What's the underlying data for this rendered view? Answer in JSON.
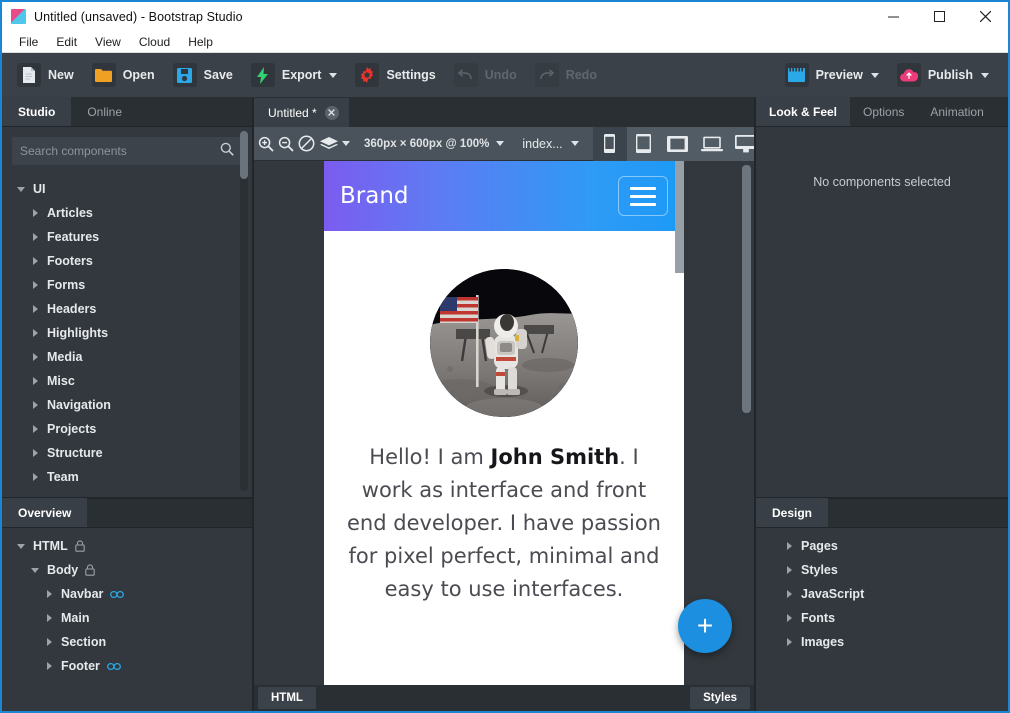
{
  "window": {
    "title": "Untitled (unsaved) - Bootstrap Studio",
    "app_icon": "bootstrap-studio-logo",
    "minimize": "minimize-icon",
    "maximize": "maximize-icon",
    "close": "close-icon"
  },
  "menubar": {
    "items": [
      {
        "label": "File"
      },
      {
        "label": "Edit"
      },
      {
        "label": "View"
      },
      {
        "label": "Cloud"
      },
      {
        "label": "Help"
      }
    ]
  },
  "toolbar": {
    "buttons": [
      {
        "label": "New",
        "icon": "new-file-icon",
        "color": "#d7dde3",
        "dropdown": false,
        "disabled": false
      },
      {
        "label": "Open",
        "icon": "folder-icon",
        "color": "#f0a023",
        "dropdown": false,
        "disabled": false
      },
      {
        "label": "Save",
        "icon": "floppy-icon",
        "color": "#2aa8e8",
        "dropdown": false,
        "disabled": false
      },
      {
        "label": "Export",
        "icon": "lightning-icon",
        "color": "#2fd46f",
        "dropdown": true,
        "disabled": false
      },
      {
        "label": "Settings",
        "icon": "gear-icon",
        "color": "#e8342c",
        "dropdown": false,
        "disabled": false
      },
      {
        "label": "Undo",
        "icon": "undo-arrow-icon",
        "color": "#8d959c",
        "dropdown": false,
        "disabled": true
      },
      {
        "label": "Redo",
        "icon": "redo-arrow-icon",
        "color": "#8d959c",
        "dropdown": false,
        "disabled": true
      }
    ],
    "right_buttons": [
      {
        "label": "Preview",
        "icon": "browser-window-icon",
        "color": "#2aa8e8",
        "dropdown": true
      },
      {
        "label": "Publish",
        "icon": "cloud-upload-icon",
        "color": "#ec3b79",
        "dropdown": true
      }
    ]
  },
  "left_panel": {
    "tabs": [
      {
        "label": "Studio",
        "active": true
      },
      {
        "label": "Online",
        "active": false
      }
    ],
    "search": {
      "placeholder": "Search components",
      "value": "",
      "icon": "search-icon"
    },
    "tree": [
      {
        "label": "UI",
        "level": 0,
        "expanded": true
      },
      {
        "label": "Articles",
        "level": 1,
        "expanded": false
      },
      {
        "label": "Features",
        "level": 1,
        "expanded": false
      },
      {
        "label": "Footers",
        "level": 1,
        "expanded": false
      },
      {
        "label": "Forms",
        "level": 1,
        "expanded": false
      },
      {
        "label": "Headers",
        "level": 1,
        "expanded": false
      },
      {
        "label": "Highlights",
        "level": 1,
        "expanded": false
      },
      {
        "label": "Media",
        "level": 1,
        "expanded": false
      },
      {
        "label": "Misc",
        "level": 1,
        "expanded": false
      },
      {
        "label": "Navigation",
        "level": 1,
        "expanded": false
      },
      {
        "label": "Projects",
        "level": 1,
        "expanded": false
      },
      {
        "label": "Structure",
        "level": 1,
        "expanded": false
      },
      {
        "label": "Team",
        "level": 1,
        "expanded": false
      }
    ]
  },
  "overview_panel": {
    "tabs": [
      {
        "label": "Overview",
        "active": true
      }
    ],
    "tree": [
      {
        "label": "HTML",
        "level": 0,
        "expanded": true,
        "badge": "lock-icon"
      },
      {
        "label": "Body",
        "level": 1,
        "expanded": true,
        "badge": "lock-icon"
      },
      {
        "label": "Navbar",
        "level": 2,
        "expanded": false,
        "badge": "link-icon"
      },
      {
        "label": "Main",
        "level": 2,
        "expanded": false,
        "badge": ""
      },
      {
        "label": "Section",
        "level": 2,
        "expanded": false,
        "badge": ""
      },
      {
        "label": "Footer",
        "level": 2,
        "expanded": false,
        "badge": "link-icon"
      }
    ]
  },
  "document_tabs": [
    {
      "label": "Untitled *",
      "active": true,
      "close": "close-tab-icon"
    }
  ],
  "canvas_toolbar": {
    "zoom_in": "zoom-in-icon",
    "zoom_out": "zoom-out-icon",
    "no_style": "no-style-icon",
    "layers": "layers-icon",
    "dimensions": "360px × 600px @ 100%",
    "file": "index...",
    "devices": [
      {
        "name": "device-phone",
        "icon": "phone-icon",
        "active": true
      },
      {
        "name": "device-phone-landscape",
        "icon": "tablet-portrait-icon",
        "active": false
      },
      {
        "name": "device-tablet",
        "icon": "tablet-landscape-icon",
        "active": false
      },
      {
        "name": "device-laptop",
        "icon": "laptop-icon",
        "active": false
      },
      {
        "name": "device-desktop",
        "icon": "desktop-icon",
        "active": false
      }
    ]
  },
  "preview": {
    "navbar": {
      "brand": "Brand",
      "toggler": "hamburger-menu-icon",
      "gradient_from": "#7b5cf0",
      "gradient_to": "#1b9af7"
    },
    "hero": {
      "avatar": "astronaut-on-moon-photo",
      "bio_prefix": "Hello! I am ",
      "bio_name": "John Smith",
      "bio_suffix": ". I work as interface and front end developer. I have passion for pixel perfect, minimal and easy to use interfaces."
    },
    "fab": {
      "label": "+",
      "icon": "plus-icon",
      "color": "#1c8fe0"
    }
  },
  "status_bar": {
    "left_button": "HTML",
    "right_button": "Styles"
  },
  "right_panel": {
    "tabs": [
      {
        "label": "Look & Feel",
        "active": true
      },
      {
        "label": "Options",
        "active": false
      },
      {
        "label": "Animation",
        "active": false
      }
    ],
    "empty_message": "No components selected"
  },
  "design_panel": {
    "tabs": [
      {
        "label": "Design",
        "active": true
      }
    ],
    "tree": [
      {
        "label": "Pages",
        "expanded": false
      },
      {
        "label": "Styles",
        "expanded": false
      },
      {
        "label": "JavaScript",
        "expanded": false
      },
      {
        "label": "Fonts",
        "expanded": false
      },
      {
        "label": "Images",
        "expanded": false
      }
    ]
  }
}
